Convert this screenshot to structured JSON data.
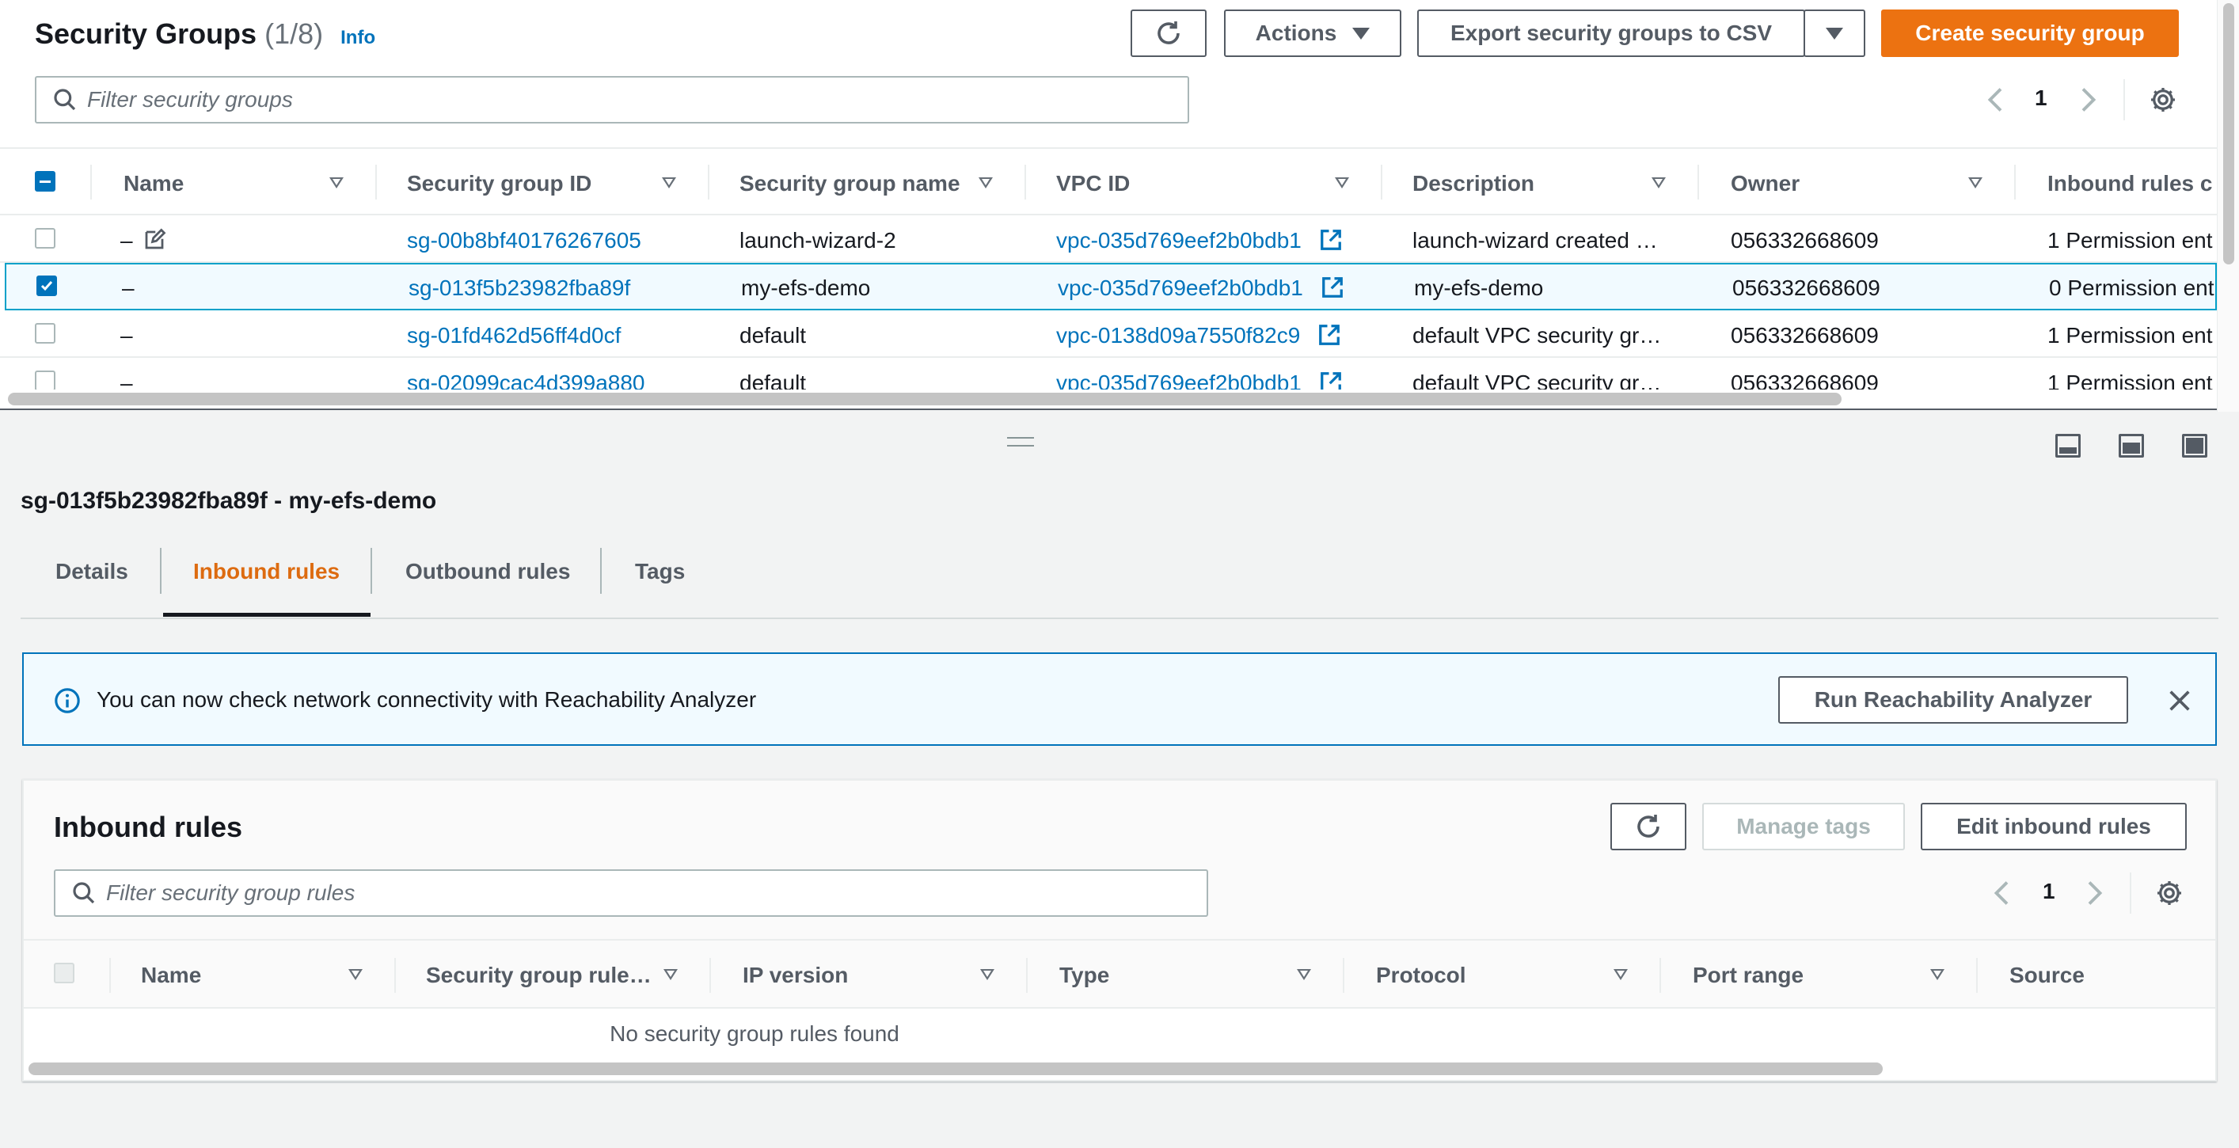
{
  "sg_panel": {
    "title": "Security Groups",
    "count": "(1/8)",
    "info": "Info",
    "actions_label": "Actions",
    "export_label": "Export security groups to CSV",
    "create_label": "Create security group",
    "filter_placeholder": "Filter security groups",
    "page": "1",
    "columns": [
      "Name",
      "Security group ID",
      "Security group name",
      "VPC ID",
      "Description",
      "Owner",
      "Inbound rules c"
    ],
    "rows": [
      {
        "name": "–",
        "id": "sg-00b8bf40176267605",
        "sgname": "launch-wizard-2",
        "vpc": "vpc-035d769eef2b0bdb1",
        "desc": "launch-wizard created …",
        "owner": "056332668609",
        "inbound": "1 Permission ent",
        "selected": false
      },
      {
        "name": "–",
        "id": "sg-013f5b23982fba89f",
        "sgname": "my-efs-demo",
        "vpc": "vpc-035d769eef2b0bdb1",
        "desc": "my-efs-demo",
        "owner": "056332668609",
        "inbound": "0 Permission ent",
        "selected": true
      },
      {
        "name": "–",
        "id": "sg-01fd462d56ff4d0cf",
        "sgname": "default",
        "vpc": "vpc-0138d09a7550f82c9",
        "desc": "default VPC security gr…",
        "owner": "056332668609",
        "inbound": "1 Permission ent",
        "selected": false
      },
      {
        "name": "–",
        "id": "sg-02099cac4d399a880",
        "sgname": "default",
        "vpc": "vpc-035d769eef2b0bdb1",
        "desc": "default VPC security gr…",
        "owner": "056332668609",
        "inbound": "1 Permission ent",
        "selected": false
      }
    ]
  },
  "detail": {
    "title": "sg-013f5b23982fba89f - my-efs-demo",
    "tabs": [
      "Details",
      "Inbound rules",
      "Outbound rules",
      "Tags"
    ],
    "active_tab": "Inbound rules",
    "banner_text": "You can now check network connectivity with Reachability Analyzer",
    "banner_button": "Run Reachability Analyzer"
  },
  "inbound": {
    "title": "Inbound rules",
    "manage_tags": "Manage tags",
    "edit_label": "Edit inbound rules",
    "filter_placeholder": "Filter security group rules",
    "page": "1",
    "columns": [
      "Name",
      "Security group rule…",
      "IP version",
      "Type",
      "Protocol",
      "Port range",
      "Source"
    ],
    "empty": "No security group rules found"
  },
  "colors": {
    "accent": "#ec7211",
    "link": "#0073bb",
    "active_tab": "#dd6b10"
  },
  "icons": [
    "refresh-icon",
    "caret-down-icon",
    "search-icon",
    "chevron-left-icon",
    "chevron-right-icon",
    "gear-icon",
    "edit-icon",
    "external-link-icon",
    "info-icon",
    "close-icon",
    "panel-layout-icon"
  ]
}
